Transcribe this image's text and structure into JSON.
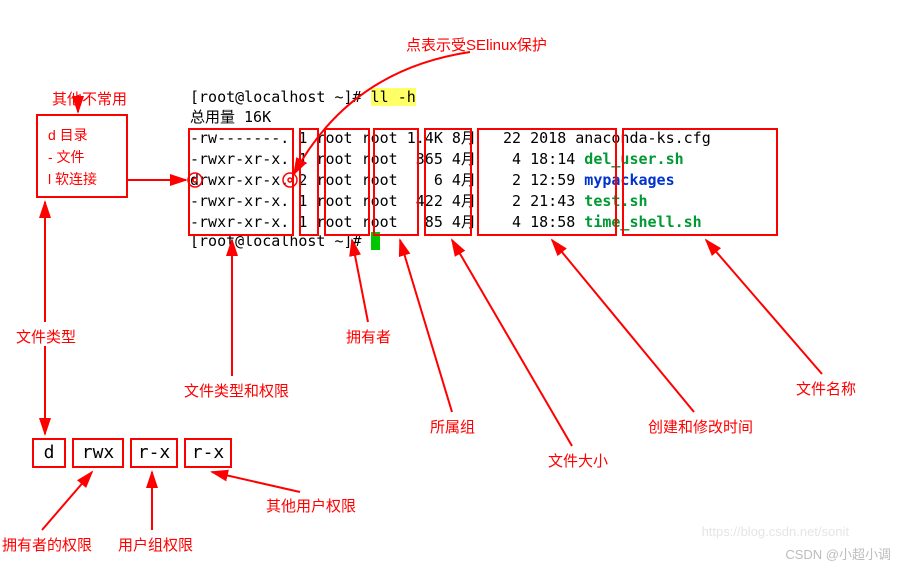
{
  "annotations": {
    "top_center": "点表示受SElinux保护",
    "uncommon_title": "其他不常用",
    "legend": {
      "d": "d 目录",
      "dash": "- 文件",
      "l": "l 软连接"
    },
    "file_type": "文件类型",
    "perm_boxes": {
      "d": "d",
      "rwx": "rwx",
      "rx1": "r-x",
      "rx2": "r-x"
    },
    "owner_perm": "拥有者的权限",
    "group_perm": "用户组权限",
    "other_perm": "其他用户权限",
    "type_and_perm": "文件类型和权限",
    "owner": "拥有者",
    "group": "所属组",
    "size": "文件大小",
    "mtime": "创建和修改时间",
    "name": "文件名称"
  },
  "terminal": {
    "prompt": "[root@localhost ~]#",
    "cmd": "ll -h",
    "total": "总用量 16K",
    "rows": [
      {
        "perm": "-rw-------.",
        "links": "1",
        "owner": "root",
        "group": "root",
        "size": "1.4K",
        "date": "8月   22 2018",
        "name": "anaconda-ks.cfg",
        "color": ""
      },
      {
        "perm": "-rwxr-xr-x.",
        "links": "1",
        "owner": "root",
        "group": "root",
        "size": " 365",
        "date": "4月    4 18:14",
        "name": "del_user.sh",
        "color": "green"
      },
      {
        "perm": "drwxr-xr-x.",
        "links": "2",
        "owner": "root",
        "group": "root",
        "size": "   6",
        "date": "4月    2 12:59",
        "name": "mypackages",
        "color": "blue"
      },
      {
        "perm": "-rwxr-xr-x.",
        "links": "1",
        "owner": "root",
        "group": "root",
        "size": " 422",
        "date": "4月    2 21:43",
        "name": "test.sh",
        "color": "green"
      },
      {
        "perm": "-rwxr-xr-x.",
        "links": "1",
        "owner": "root",
        "group": "root",
        "size": "  85",
        "date": "4月    4 18:58",
        "name": "time_shell.sh",
        "color": "green"
      }
    ]
  },
  "watermark": "https://blog.csdn.net/sonit",
  "credit": "CSDN @小超小调"
}
